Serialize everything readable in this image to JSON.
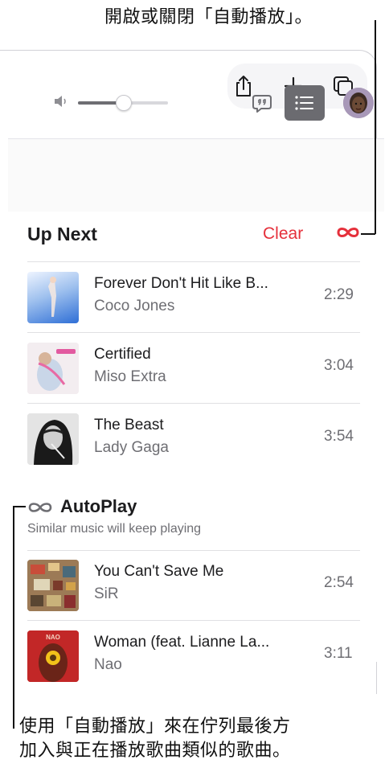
{
  "callouts": {
    "top": "開啟或關閉「自動播放」。",
    "bottom_line1": "使用「自動播放」來在佇列最後方",
    "bottom_line2": "加入與正在播放歌曲類似的歌曲。"
  },
  "toolbar": {
    "share_icon": "share-icon",
    "add_icon": "plus-icon",
    "miniplayer_icon": "miniplayer-icon"
  },
  "playback": {
    "volume_level": 0.5,
    "lyrics_icon": "lyrics-icon",
    "queue_icon": "list-icon",
    "queue_active": true
  },
  "up_next": {
    "title": "Up Next",
    "clear_label": "Clear",
    "autoplay_enabled": true,
    "tracks": [
      {
        "title": "Forever Don't Hit Like B...",
        "artist": "Coco Jones",
        "duration": "2:29"
      },
      {
        "title": "Certified",
        "artist": "Miso Extra",
        "duration": "3:04"
      },
      {
        "title": "The Beast",
        "artist": "Lady Gaga",
        "duration": "3:54"
      }
    ]
  },
  "autoplay": {
    "title": "AutoPlay",
    "subtitle": "Similar music will keep playing",
    "tracks": [
      {
        "title": "You Can't Save Me",
        "artist": "SiR",
        "duration": "2:54"
      },
      {
        "title": "Woman (feat. Lianne La...",
        "artist": "Nao",
        "duration": "3:11"
      }
    ]
  },
  "colors": {
    "accent": "#e5303b",
    "secondary_text": "#6e6e73",
    "queue_button_bg": "#6b6b70"
  }
}
